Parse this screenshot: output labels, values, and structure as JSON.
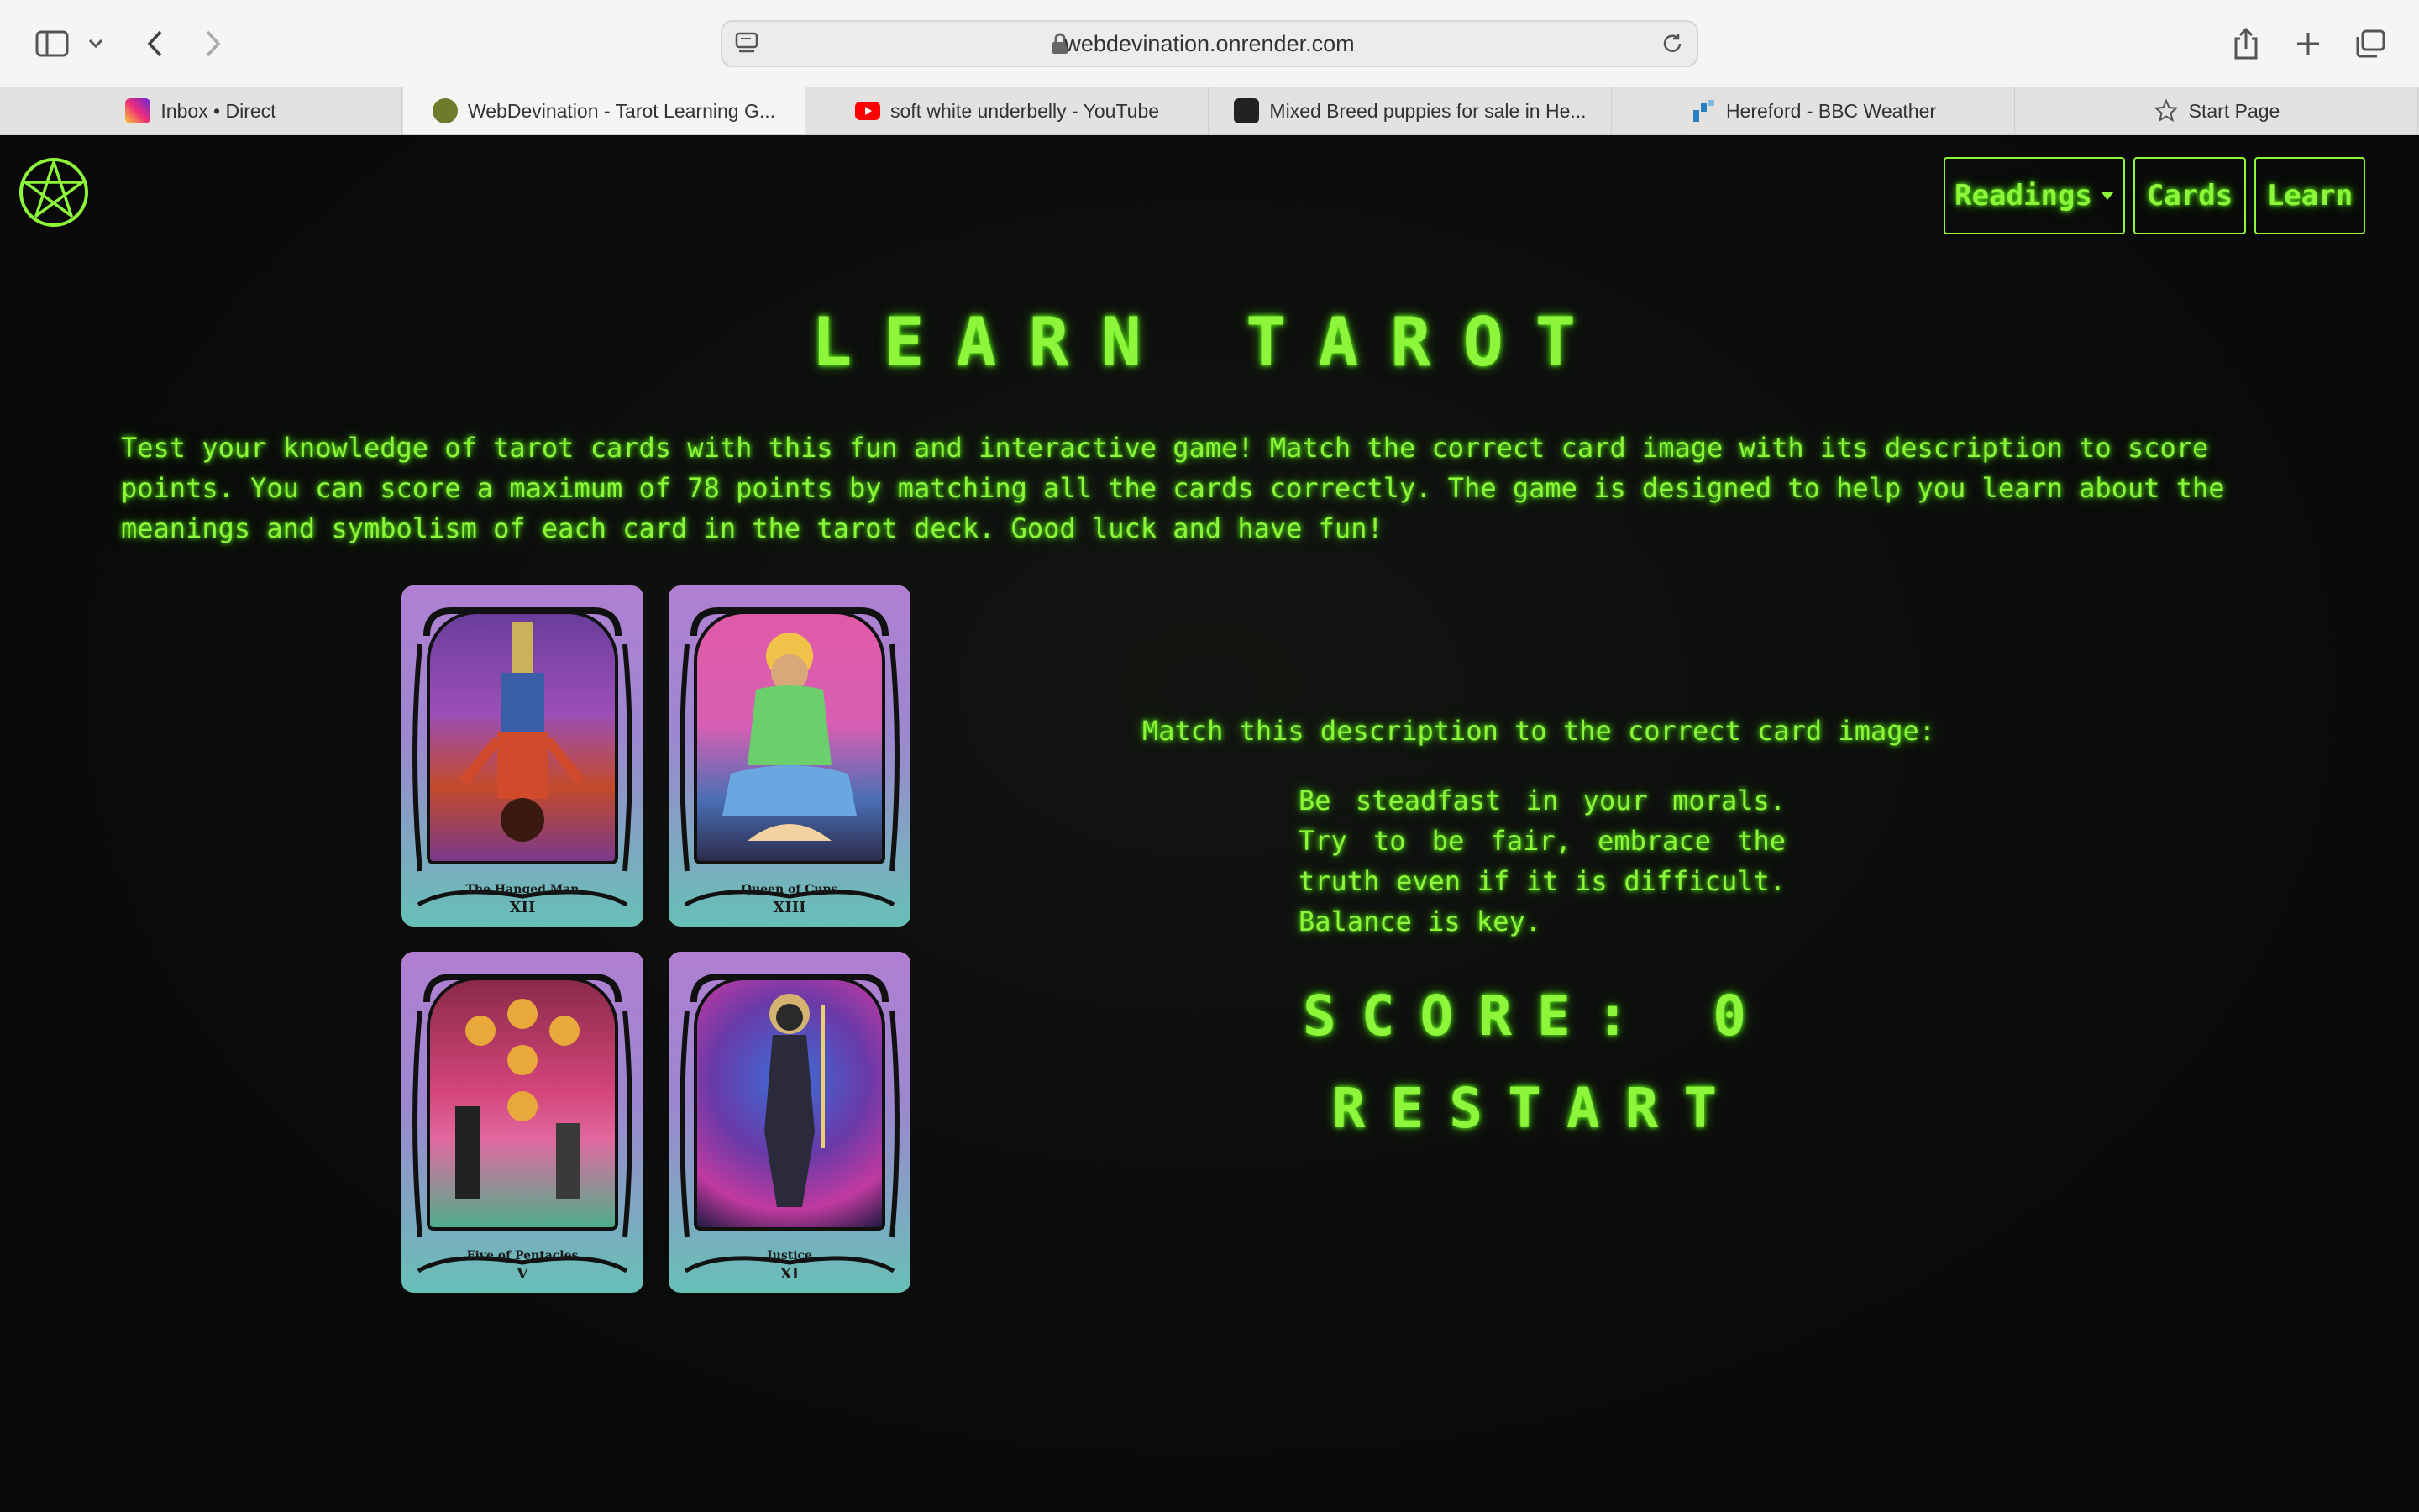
{
  "browser": {
    "url": "webdevination.onrender.com",
    "tabs": [
      {
        "label": "Inbox • Direct",
        "icon": "instagram-icon",
        "color": "#d62976"
      },
      {
        "label": "WebDevination - Tarot Learning G...",
        "icon": "webdevination-icon",
        "color": "#6d7b2c",
        "active": true
      },
      {
        "label": "soft white underbelly - YouTube",
        "icon": "youtube-icon",
        "color": "#ff0000"
      },
      {
        "label": "Mixed Breed puppies for sale in He...",
        "icon": "pets-icon",
        "color": "#222222"
      },
      {
        "label": "Hereford - BBC Weather",
        "icon": "bbc-weather-icon",
        "color": "#2a7fc1"
      },
      {
        "label": "Start Page",
        "icon": "star-icon",
        "color": "#555555"
      }
    ]
  },
  "nav": {
    "readings": "Readings",
    "cards": "Cards",
    "learn": "Learn"
  },
  "page": {
    "title": "LEARN TAROT",
    "intro": "Test your knowledge of tarot cards with this fun and interactive game! Match the correct card image with its description to score points. You can score a maximum of 78 points by matching all the cards correctly. The game is designed to help you learn about the meanings and symbolism of each card in the tarot deck. Good luck and have fun!",
    "prompt": "Match this description to the correct card image:",
    "description": "Be steadfast in your morals. Try to be fair, embrace the truth even if it is difficult. Balance is key.",
    "score_label": "SCORE: 0",
    "restart_label": "RESTART"
  },
  "cards": [
    {
      "name": "The Hanged Man",
      "numeral": "XII"
    },
    {
      "name": "Queen of Cups",
      "numeral": "XIII"
    },
    {
      "name": "Five of Pentacles",
      "numeral": "V"
    },
    {
      "name": "Justice",
      "numeral": "XI"
    }
  ],
  "colors": {
    "accent": "#8df53a",
    "background": "#0a0b0a"
  }
}
